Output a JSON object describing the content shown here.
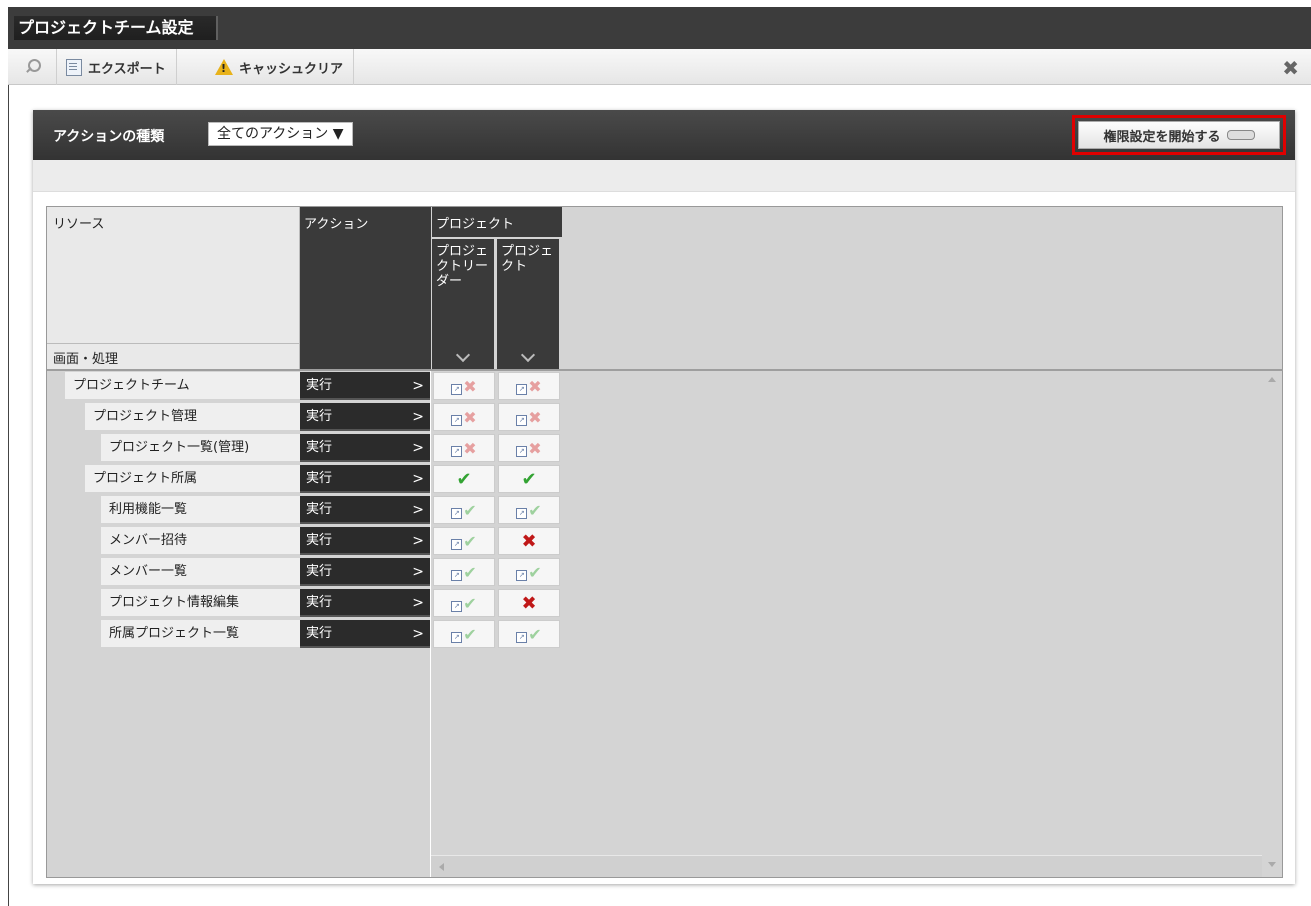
{
  "window": {
    "title": "プロジェクトチーム設定"
  },
  "toolbar": {
    "search_icon": "search-icon",
    "export_label": "エクスポート",
    "cache_clear_label": "キャッシュクリア",
    "close_icon": "✖"
  },
  "panel": {
    "action_type_label": "アクションの種類",
    "action_select_value": "全てのアクション ▼",
    "start_button_label": "権限設定を開始する"
  },
  "grid": {
    "resource_header": "リソース",
    "screen_process_header": "画面・処理",
    "action_header": "アクション",
    "project_group_header": "プロジェクト",
    "roles": [
      "プロジェクトリーダー",
      "プロジェクト"
    ],
    "rows": [
      {
        "name": "プロジェクトチーム",
        "indent": 1,
        "action": "実行",
        "cells": [
          "denied-inherited",
          "denied-inherited"
        ]
      },
      {
        "name": "プロジェクト管理",
        "indent": 2,
        "action": "実行",
        "cells": [
          "denied-inherited",
          "denied-inherited"
        ]
      },
      {
        "name": "プロジェクト一覧(管理)",
        "indent": 3,
        "action": "実行",
        "cells": [
          "denied-inherited",
          "denied-inherited"
        ]
      },
      {
        "name": "プロジェクト所属",
        "indent": 2,
        "action": "実行",
        "cells": [
          "allowed",
          "allowed"
        ]
      },
      {
        "name": "利用機能一覧",
        "indent": 3,
        "action": "実行",
        "cells": [
          "allowed-inherited",
          "allowed-inherited"
        ]
      },
      {
        "name": "メンバー招待",
        "indent": 3,
        "action": "実行",
        "cells": [
          "allowed-inherited",
          "denied"
        ]
      },
      {
        "name": "メンバー一覧",
        "indent": 3,
        "action": "実行",
        "cells": [
          "allowed-inherited",
          "allowed-inherited"
        ]
      },
      {
        "name": "プロジェクト情報編集",
        "indent": 3,
        "action": "実行",
        "cells": [
          "allowed-inherited",
          "denied"
        ]
      },
      {
        "name": "所属プロジェクト一覧",
        "indent": 3,
        "action": "実行",
        "cells": [
          "allowed-inherited",
          "allowed-inherited"
        ]
      }
    ]
  },
  "colors": {
    "highlight": "#e00000",
    "allowed": "#33a333",
    "denied": "#c01818"
  }
}
